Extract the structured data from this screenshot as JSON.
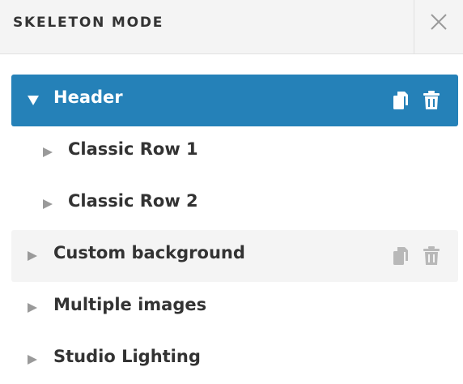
{
  "panel": {
    "title": "SKELETON MODE",
    "close_icon": "close-icon"
  },
  "tree": {
    "items": [
      {
        "label": "Header",
        "state": "selected",
        "expanded": true,
        "level": 0,
        "actions": [
          "duplicate-icon",
          "trash-icon"
        ]
      },
      {
        "label": "Classic Row 1",
        "state": "normal",
        "expanded": false,
        "level": 1
      },
      {
        "label": "Classic Row 2",
        "state": "normal",
        "expanded": false,
        "level": 1
      },
      {
        "label": "Custom background",
        "state": "hovered",
        "expanded": false,
        "level": 0,
        "actions": [
          "duplicate-icon",
          "trash-icon"
        ]
      },
      {
        "label": "Multiple images",
        "state": "normal",
        "expanded": false,
        "level": 0
      },
      {
        "label": "Studio Lighting",
        "state": "normal",
        "expanded": false,
        "level": 0
      }
    ]
  },
  "colors": {
    "selected_bg": "#2581b8",
    "hover_bg": "#f4f4f4",
    "text": "#333333",
    "caret": "#9a9a9a",
    "muted_icon": "#b8b8b8"
  }
}
